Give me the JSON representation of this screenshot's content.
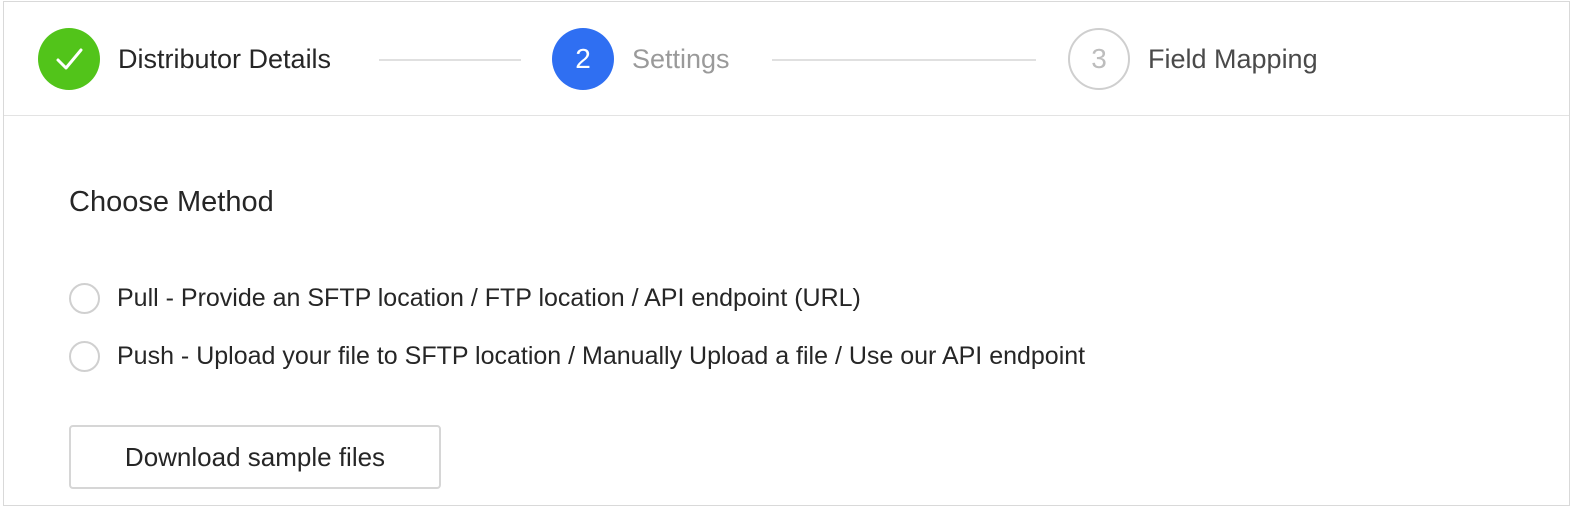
{
  "stepper": {
    "steps": [
      {
        "number": "",
        "label": "Distributor Details",
        "status": "completed"
      },
      {
        "number": "2",
        "label": "Settings",
        "status": "active"
      },
      {
        "number": "3",
        "label": "Field Mapping",
        "status": "pending"
      }
    ]
  },
  "colors": {
    "completed": "#52c41a",
    "active": "#2f6ff2",
    "pending_border": "#cfcfcf"
  },
  "icons": {
    "completed_step": "checkmark-icon"
  },
  "method": {
    "title": "Choose Method",
    "options": [
      {
        "label": "Pull - Provide an SFTP location / FTP location / API endpoint (URL)",
        "selected": false
      },
      {
        "label": "Push - Upload your file to SFTP location / Manually Upload a file / Use our API endpoint",
        "selected": false
      }
    ]
  },
  "actions": {
    "download_label": "Download sample files"
  }
}
